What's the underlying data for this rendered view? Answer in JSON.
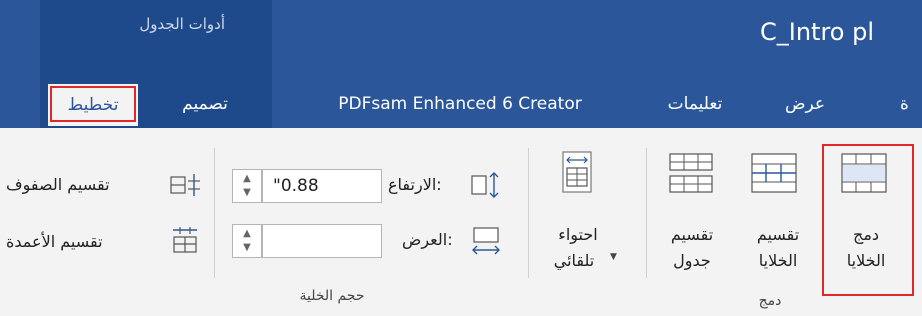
{
  "title_bar": {
    "contextual_group": "أدوات الجدول",
    "document_title": "C_Intro pl"
  },
  "tabs": {
    "layout": "تخطيط",
    "design": "تصميم",
    "pdfsam": "PDFsam Enhanced 6 Creator",
    "help": "تعليمات",
    "view": "عرض",
    "partial": "ة"
  },
  "ribbon": {
    "merge_group": {
      "label": "دمج",
      "merge_cells": [
        "دمج",
        "الخلايا"
      ],
      "split_cells": [
        "تقسيم",
        "الخلايا"
      ],
      "split_table": [
        "تقسيم",
        "جدول"
      ]
    },
    "autofit": {
      "line1": "احتواء",
      "line2": "تلقائي"
    },
    "cell_size_group": {
      "label": "حجم الخلية",
      "height_label": "الارتفاع:",
      "height_value": "\"0.88",
      "width_label": "العرض:",
      "width_value": "",
      "distribute_rows": "تقسيم الصفوف",
      "distribute_columns": "تقسيم الأعمدة"
    }
  },
  "colors": {
    "title_bar": "#2b579a",
    "contextual_group": "#1e4a8c",
    "ribbon": "#f3f3f3",
    "highlight_box": "#e02828"
  }
}
